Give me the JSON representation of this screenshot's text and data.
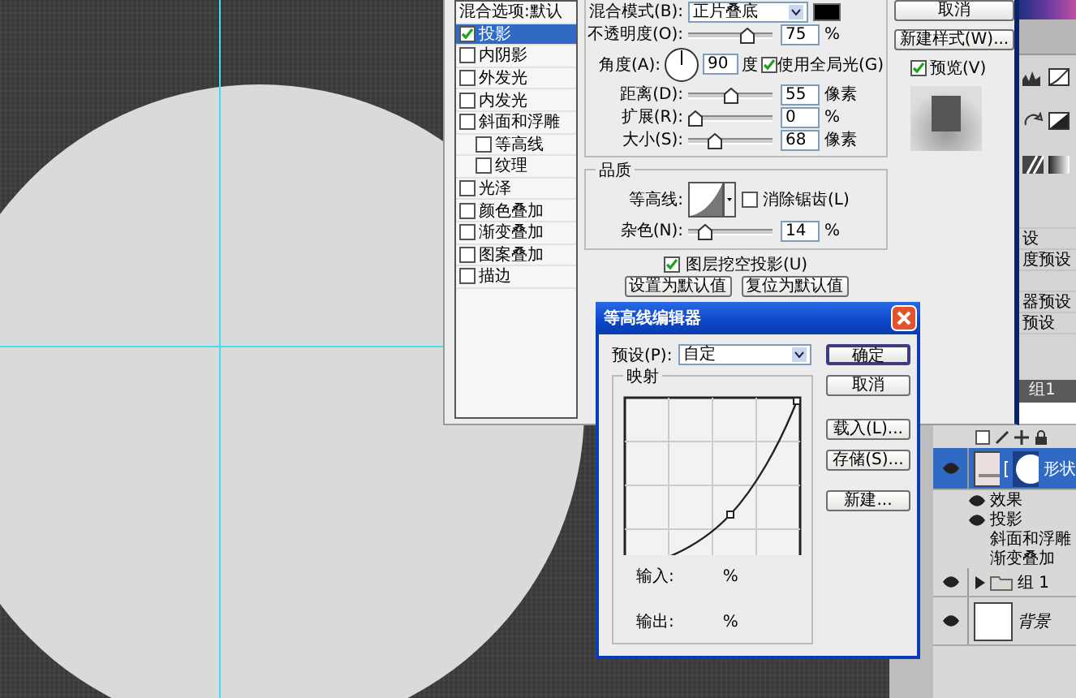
{
  "layer_style": {
    "styles": [
      {
        "label": "混合选项:默认",
        "kind": "header",
        "selected": false
      },
      {
        "label": "投影",
        "kind": "effect",
        "checked": true,
        "selected": true
      },
      {
        "label": "内阴影",
        "kind": "effect",
        "checked": false,
        "selected": false
      },
      {
        "label": "外发光",
        "kind": "effect",
        "checked": false,
        "selected": false
      },
      {
        "label": "内发光",
        "kind": "effect",
        "checked": false,
        "selected": false
      },
      {
        "label": "斜面和浮雕",
        "kind": "effect",
        "checked": false,
        "selected": false,
        "children": [
          {
            "label": "等高线",
            "kind": "effect",
            "checked": false,
            "selected": false
          },
          {
            "label": "纹理",
            "kind": "effect",
            "checked": false,
            "selected": false
          }
        ]
      },
      {
        "label": "光泽",
        "kind": "effect",
        "checked": false,
        "selected": false
      },
      {
        "label": "颜色叠加",
        "kind": "effect",
        "checked": false,
        "selected": false
      },
      {
        "label": "渐变叠加",
        "kind": "effect",
        "checked": false,
        "selected": false
      },
      {
        "label": "图案叠加",
        "kind": "effect",
        "checked": false,
        "selected": false
      },
      {
        "label": "描边",
        "kind": "effect",
        "checked": false,
        "selected": false
      }
    ],
    "blend_mode": {
      "label": "混合模式(B):",
      "value": "正片叠底"
    },
    "opacity": {
      "label": "不透明度(O):",
      "level": 0.75,
      "value": "75",
      "unit": "%"
    },
    "angle": {
      "label": "角度(A):",
      "value": "90",
      "unit": "度"
    },
    "global_light": {
      "label": "使用全局光(G)",
      "checked": true
    },
    "distance": {
      "label": "距离(D):",
      "level": 0.5,
      "value": "55",
      "unit": "像素"
    },
    "spread": {
      "label": "扩展(R):",
      "level": 0,
      "value": "0",
      "unit": "%"
    },
    "size": {
      "label": "大小(S):",
      "level": 0.28,
      "value": "68",
      "unit": "像素"
    },
    "quality": {
      "title": "品质",
      "contour_label": "等高线:",
      "anti_alias": {
        "label": "消除锯齿(L)",
        "checked": false
      },
      "noise": {
        "label": "杂色(N):",
        "level": 0.14,
        "value": "14",
        "unit": "%"
      }
    },
    "knockout": {
      "label": "图层挖空投影(U)",
      "checked": true
    },
    "buttons": [
      "设置为默认值",
      "复位为默认值"
    ],
    "side_buttons": [
      "取消",
      "新建样式(W)..."
    ],
    "preview": {
      "label": "预览(V)",
      "checked": true
    }
  },
  "contour_editor": {
    "title": "等高线编辑器",
    "preset_label": "预设(P):",
    "preset": "自定",
    "mapping_title": "映射",
    "input_label": "输入:",
    "input_unit": "%",
    "output_label": "输出:",
    "output_unit": "%",
    "buttons": [
      {
        "label": "确定",
        "default": true
      },
      {
        "label": "取消",
        "default": false
      },
      {
        "label": "载入(L)...",
        "default": false
      },
      {
        "label": "存储(S)...",
        "default": false
      },
      {
        "label": "新建...",
        "default": false
      }
    ]
  },
  "adjustment_presets": [
    "设",
    "度预设",
    "器预设",
    "预设"
  ],
  "layers_panel": {
    "tab": "组1",
    "layers": [
      {
        "name": "形状",
        "kind": "shape",
        "selected": true,
        "effects_label": "效果",
        "effects": [
          {
            "label": "投影",
            "visible": true
          },
          {
            "label": "斜面和浮雕",
            "visible": false
          },
          {
            "label": "渐变叠加",
            "visible": false
          }
        ]
      },
      {
        "name": "组 1",
        "kind": "group",
        "selected": false,
        "expanded": false
      },
      {
        "name": "背景",
        "kind": "background",
        "selected": false
      }
    ]
  }
}
